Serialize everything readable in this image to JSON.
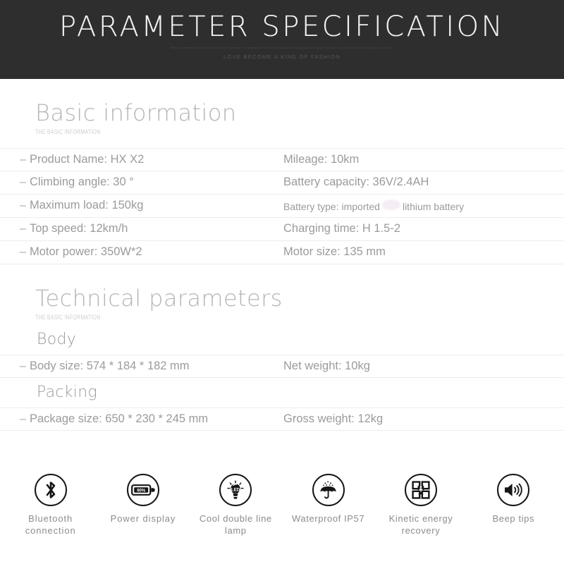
{
  "header": {
    "title": "PARAMETER SPECIFICATION",
    "micro_text": "Please pay attention to the product parameters before purchase. The parameters are for reference only and the actual product shall prevail. Thank you for your understanding and support of our products.",
    "subtitle": "LOVE BECOME A KIND OF FASHION"
  },
  "basic_section": {
    "title": "Basic information",
    "subtitle": "THE BASIC INFORMATION",
    "rows": [
      {
        "left": "Product Name: HX  X2",
        "right": "Mileage: 10km"
      },
      {
        "left": "Climbing angle: 30 °",
        "right": "Battery capacity: 36V/2.4AH"
      },
      {
        "left": "Maximum load: 150kg",
        "right_pre": "Battery type: imported",
        "right_post": "lithium battery",
        "right_redacted": true
      },
      {
        "left": "Top speed: 12km/h",
        "right": "Charging time: H 1.5-2"
      },
      {
        "left": "Motor power: 350W*2",
        "right": "Motor size: 135 mm"
      }
    ]
  },
  "technical_section": {
    "title": "Technical parameters",
    "subtitle": "THE BASIC INFORMATION",
    "body_heading": "Body",
    "body_rows": [
      {
        "left": "Body size: 574 * 184 * 182 mm",
        "right": "Net weight: 10kg"
      }
    ],
    "packing_heading": "Packing",
    "packing_rows": [
      {
        "left": "Package size: 650 * 230 * 245 mm",
        "right": "Gross weight: 12kg"
      }
    ]
  },
  "features": [
    {
      "icon": "bluetooth-icon",
      "label": "Bluetooth connection"
    },
    {
      "icon": "battery-display-icon",
      "label": "Power display",
      "badge": "90%"
    },
    {
      "icon": "led-bulb-icon",
      "label": "Cool double line lamp",
      "badge": "LED"
    },
    {
      "icon": "umbrella-rain-icon",
      "label": "Waterproof IP57"
    },
    {
      "icon": "energy-recovery-icon",
      "label": "Kinetic energy recovery"
    },
    {
      "icon": "speaker-icon",
      "label": "Beep tips"
    }
  ],
  "colors": {
    "banner_bg": "#2e2e2e",
    "banner_text": "#f2f2f2",
    "heading": "#b4b4b4",
    "body_text": "#9b9b9b",
    "divider": "#ededed",
    "icon_stroke": "#161616",
    "redaction": "#f6ecf4"
  }
}
